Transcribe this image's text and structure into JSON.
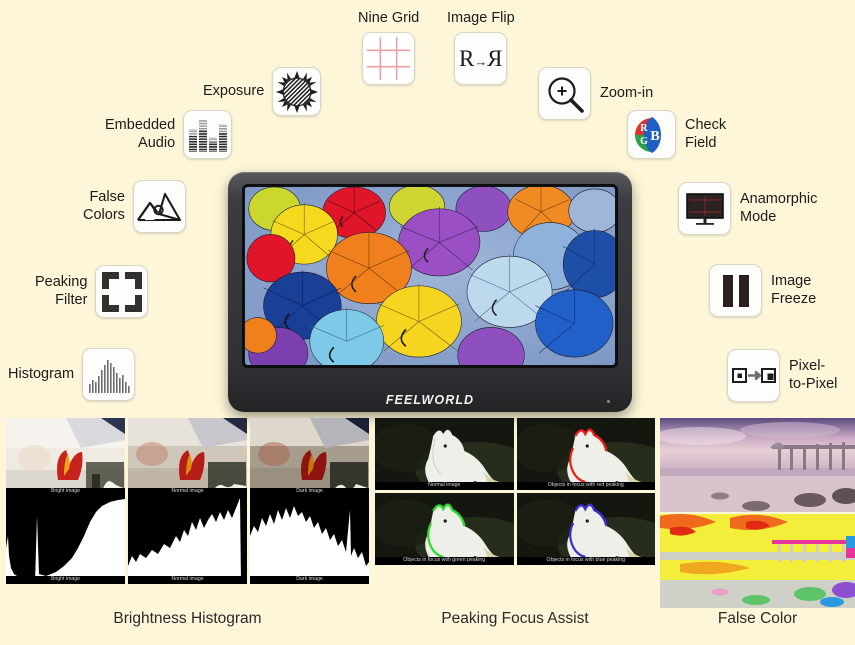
{
  "page": {
    "background_color": "#fdf6d8",
    "brand": "FEELWORLD"
  },
  "features": [
    {
      "id": "nine-grid",
      "label": "Nine Grid",
      "icon": "nine-grid-icon",
      "position": "top"
    },
    {
      "id": "image-flip",
      "label": "Image Flip",
      "icon": "image-flip-icon",
      "position": "top",
      "glyph": "R-Я"
    },
    {
      "id": "exposure",
      "label": "Exposure",
      "icon": "exposure-sun-icon",
      "position": "left"
    },
    {
      "id": "embedded-audio",
      "label": "Embedded\nAudio",
      "icon": "audio-bars-icon",
      "position": "left"
    },
    {
      "id": "false-colors",
      "label": "False\nColors",
      "icon": "mountain-icon",
      "position": "left"
    },
    {
      "id": "peaking-filter",
      "label": "Peaking\nFilter",
      "icon": "focus-brackets-icon",
      "position": "left"
    },
    {
      "id": "histogram",
      "label": "Histogram",
      "icon": "histogram-icon",
      "position": "left"
    },
    {
      "id": "zoom-in",
      "label": "Zoom-in",
      "icon": "magnifier-plus-icon",
      "position": "right"
    },
    {
      "id": "check-field",
      "label": "Check\nField",
      "icon": "rgb-check-field-icon",
      "position": "right",
      "letters": [
        "R",
        "G",
        "B"
      ]
    },
    {
      "id": "anamorphic",
      "label": "Anamorphic\nMode",
      "icon": "monitor-icon",
      "position": "right"
    },
    {
      "id": "image-freeze",
      "label": "Image\nFreeze",
      "icon": "pause-icon",
      "position": "right"
    },
    {
      "id": "pixel-to-pixel",
      "label": "Pixel-\nto-Pixel",
      "icon": "pixel-map-icon",
      "position": "right"
    }
  ],
  "bottom_panels": [
    {
      "id": "brightness-histogram",
      "caption": "Brightness Histogram",
      "cells": [
        {
          "photo_label": "Bright image",
          "hist_label": "Bright image"
        },
        {
          "photo_label": "Normal image",
          "hist_label": "Normal image"
        },
        {
          "photo_label": "Dark image",
          "hist_label": "Dark image"
        }
      ]
    },
    {
      "id": "peaking-focus-assist",
      "caption": "Peaking Focus Assist",
      "cells": [
        {
          "label": "Normal image",
          "peak_color": "none"
        },
        {
          "label": "Objects in focus with red peaking",
          "peak_color": "#e8201c"
        },
        {
          "label": "Objects in focus with green peaking",
          "peak_color": "#2fd92f"
        },
        {
          "label": "Objects in focus with blue peaking",
          "peak_color": "#3a2fd0"
        }
      ]
    },
    {
      "id": "false-color",
      "caption": "False Color",
      "cells": [
        {
          "label": "normal pier photo"
        },
        {
          "label": "false color pier photo"
        }
      ]
    }
  ],
  "colors": {
    "grid_line": "#f0a0a0",
    "red": "#d9342b",
    "green": "#2ba24a",
    "blue": "#1f5fc4",
    "icon_dark": "#33312e",
    "bezel": "#34363a"
  }
}
